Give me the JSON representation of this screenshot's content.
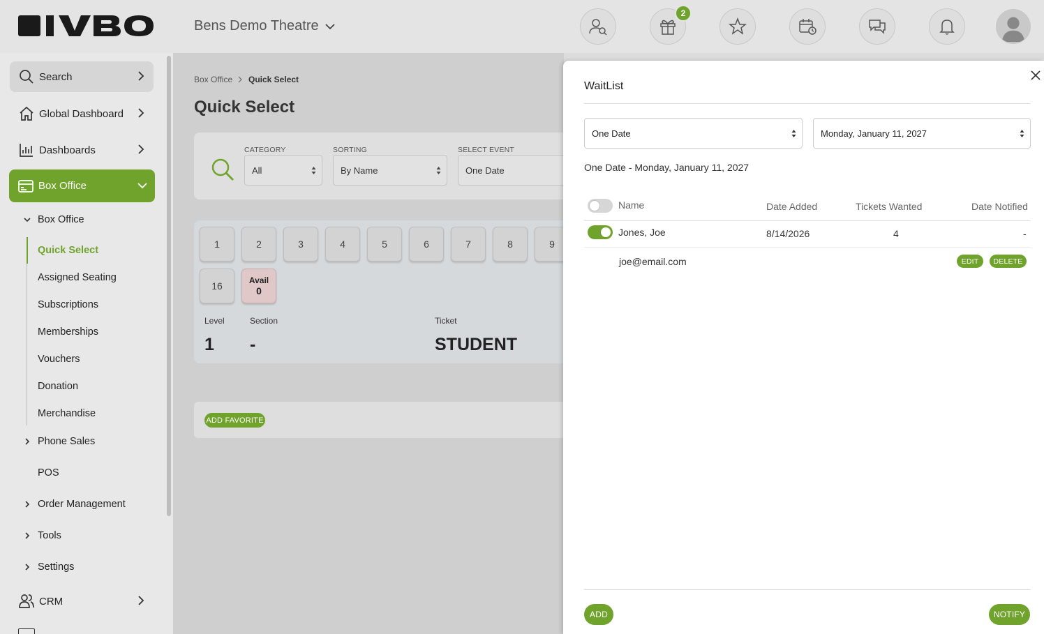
{
  "app": {
    "logo_text": "IVBO",
    "venue": "Bens Demo Theatre",
    "notification_count": "2"
  },
  "topbar_icons": [
    "user-search-icon",
    "gift-box-icon",
    "star-icon",
    "calendar-clock-icon",
    "chat-icon",
    "bell-icon",
    "avatar"
  ],
  "sidebar": {
    "search": "Search",
    "global_dashboard": "Global Dashboard",
    "dashboards": "Dashboards",
    "box_office": "Box Office",
    "sub_box_office": "Box Office",
    "items": [
      "Quick Select",
      "Assigned Seating",
      "Subscriptions",
      "Memberships",
      "Vouchers",
      "Donation",
      "Merchandise"
    ],
    "phone_sales": "Phone Sales",
    "pos": "POS",
    "order_management": "Order Management",
    "tools": "Tools",
    "settings": "Settings",
    "crm": "CRM"
  },
  "breadcrumb": {
    "parent": "Box Office",
    "current": "Quick Select"
  },
  "page_title": "Quick Select",
  "filters": {
    "category_label": "CATEGORY",
    "category_value": "All",
    "sorting_label": "SORTING",
    "sorting_value": "By Name",
    "event_label": "SELECT EVENT",
    "event_value": "One Date"
  },
  "quantity_buttons": [
    "1",
    "2",
    "3",
    "4",
    "5",
    "6",
    "7",
    "8",
    "9",
    "16"
  ],
  "avail": {
    "label": "Avail",
    "value": "0"
  },
  "ticket_info": {
    "level_label": "Level",
    "level_value": "1",
    "section_label": "Section",
    "section_value": "-",
    "ticket_label": "Ticket",
    "ticket_value": "STUDENT"
  },
  "add_favorite": "ADD FAVORITE",
  "waitlist": {
    "title": "WaitList",
    "type_select": "One Date",
    "date_select": "Monday, January 11, 2027",
    "subtitle": "One Date - Monday, January 11, 2027",
    "headers": {
      "name": "Name",
      "date_added": "Date Added",
      "tickets_wanted": "Tickets Wanted",
      "date_notified": "Date Notified"
    },
    "rows": [
      {
        "name": "Jones, Joe",
        "date_added": "8/14/2026",
        "tickets_wanted": "4",
        "date_notified": "-",
        "email": "joe@email.com",
        "selected": true
      }
    ],
    "edit": "EDIT",
    "delete": "DELETE",
    "add": "ADD",
    "notify": "NOTIFY"
  },
  "colors": {
    "accent": "#6fa32b",
    "avail_tile": "#e0c8c8"
  }
}
